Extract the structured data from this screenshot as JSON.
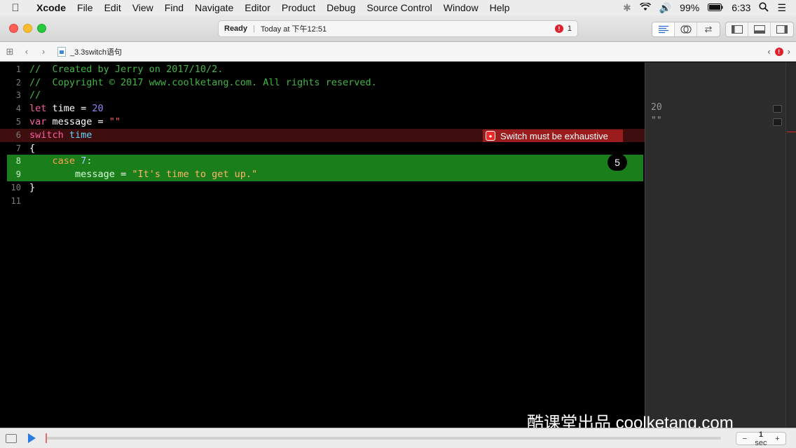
{
  "menubar": {
    "apple": "",
    "items": [
      "Xcode",
      "File",
      "Edit",
      "View",
      "Find",
      "Navigate",
      "Editor",
      "Product",
      "Debug",
      "Source Control",
      "Window",
      "Help"
    ],
    "battery": "99%",
    "clock": "6:33"
  },
  "toolbar": {
    "status_ready": "Ready",
    "status_time": "Today at 下午12:51",
    "error_count": "1"
  },
  "jumpbar": {
    "filename": "_3.3switch语句"
  },
  "editor": {
    "lines": [
      {
        "n": "1",
        "t": "//  Created by Jerry on 2017/10/2."
      },
      {
        "n": "2",
        "t": "//  Copyright © 2017 www.coolketang.com. All rights reserved."
      },
      {
        "n": "3",
        "t": "//"
      },
      {
        "n": "4",
        "kw": "let",
        "rest": " time = ",
        "num": "20"
      },
      {
        "n": "5",
        "kw": "var",
        "rest": " message = ",
        "str": "\"\""
      },
      {
        "n": "6",
        "kw": "switch",
        "rest": " ",
        "id": "time"
      },
      {
        "n": "7",
        "t": "{"
      },
      {
        "n": "8",
        "indent": "    ",
        "kw": "case",
        "rest": " ",
        "num": "7",
        "tail": ":"
      },
      {
        "n": "9",
        "indent": "        ",
        "id": "message",
        "rest": " = ",
        "str": "\"It's time to get up.\""
      },
      {
        "n": "10",
        "t": "}"
      },
      {
        "n": "11",
        "t": ""
      }
    ],
    "error_message": "Switch must be exhaustive",
    "step_badge": "5"
  },
  "results": {
    "line4": "20",
    "line5": "\"\""
  },
  "watermark": "酷课堂出品 coolketang.com",
  "debugbar": {
    "stepper_minus": "−",
    "stepper_value": "1",
    "stepper_unit": "sec",
    "stepper_plus": "+"
  }
}
